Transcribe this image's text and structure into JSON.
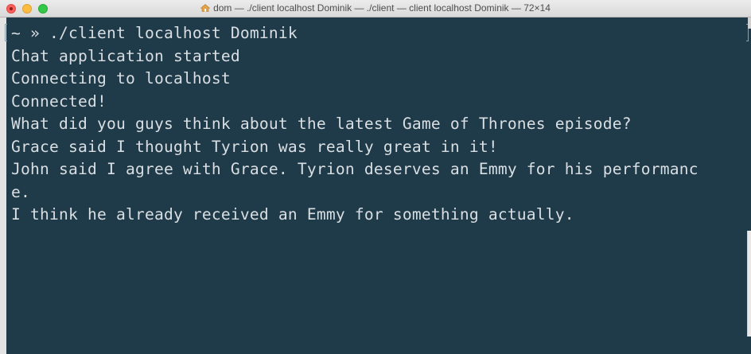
{
  "window": {
    "title": "dom — ./client localhost Dominik — ./client — client localhost Dominik — 72×14",
    "title_icon": "home-icon"
  },
  "colors": {
    "terminal_background": "#1f3a48",
    "terminal_text": "#d9dfe3"
  },
  "terminal": {
    "lines": [
      "~ » ./client localhost Dominik",
      "Chat application started",
      "Connecting to localhost",
      "Connected!",
      "What did you guys think about the latest Game of Thrones episode?",
      "Grace said I thought Tyrion was really great in it!",
      "John said I agree with Grace. Tyrion deserves an Emmy for his performanc",
      "e.",
      "I think he already received an Emmy for something actually."
    ]
  }
}
